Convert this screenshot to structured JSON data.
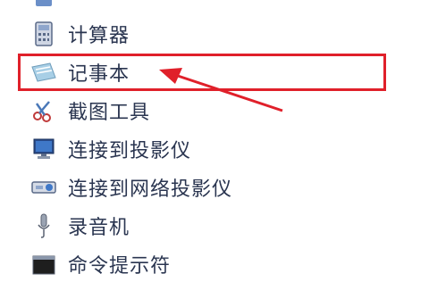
{
  "menu": {
    "items": [
      {
        "label": "",
        "icon": "partial-icon"
      },
      {
        "label": "计算器",
        "icon": "calculator-icon"
      },
      {
        "label": "记事本",
        "icon": "notepad-icon"
      },
      {
        "label": "截图工具",
        "icon": "snipping-tool-icon"
      },
      {
        "label": "连接到投影仪",
        "icon": "projector-icon"
      },
      {
        "label": "连接到网络投影仪",
        "icon": "network-projector-icon"
      },
      {
        "label": "录音机",
        "icon": "microphone-icon"
      },
      {
        "label": "命令提示符",
        "icon": "command-prompt-icon"
      }
    ]
  },
  "annotation": {
    "highlight_color": "#e0202a",
    "highlighted_item": "记事本"
  }
}
